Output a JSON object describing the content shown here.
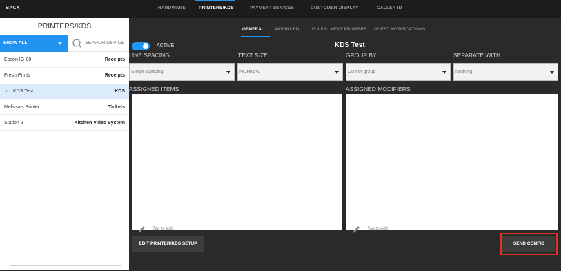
{
  "topbar": {
    "back_label": "BACK",
    "tabs": [
      {
        "label": "HARDWARE",
        "active": false
      },
      {
        "label": "PRINTERS/KDS",
        "active": true
      },
      {
        "label": "PAYMENT DEVICES",
        "active": false
      },
      {
        "label": "CUSTOMER DISPLAY",
        "active": false
      },
      {
        "label": "CALLER ID",
        "active": false
      }
    ]
  },
  "sidebar": {
    "title": "PRINTERS/KDS",
    "filter_label": "SHOW ALL",
    "search_placeholder": "SEARCH DEVICE",
    "devices": [
      {
        "name": "Epson IG-88",
        "type": "Receipts",
        "selected": false
      },
      {
        "name": "Fresh Prints",
        "type": "Receipts",
        "selected": false
      },
      {
        "name": "KDS Test",
        "type": "KDS",
        "selected": true
      },
      {
        "name": "Melissa's Printer",
        "type": "Tickets",
        "selected": false
      },
      {
        "name": "Station 2",
        "type": "Kitchen Video System",
        "selected": false
      }
    ],
    "check_glyph": "✓"
  },
  "subtabs": [
    {
      "label": "GENERAL",
      "active": true
    },
    {
      "label": "ADVANCED",
      "active": false
    },
    {
      "label": "FULFILLMENT PRINTERS",
      "active": false
    },
    {
      "label": "GUEST NOTIFICATIONS",
      "active": false
    }
  ],
  "form": {
    "active_label": "ACTIVE",
    "active_on": true,
    "device_title": "KDS Test",
    "fields": [
      {
        "label": "LINE SPACING",
        "value": "Single Spacing"
      },
      {
        "label": "TEXT SIZE",
        "value": "NORMAL"
      },
      {
        "label": "GROUP BY",
        "value": "Do not group"
      },
      {
        "label": "SEPARATE WITH",
        "value": "Nothing"
      }
    ],
    "assigned_items_label": "ASSIGNED ITEMS",
    "assigned_modifiers_label": "ASSIGNED MODIFIERS",
    "tap_to_edit": "Tap to edit"
  },
  "actions": {
    "edit_setup_label": "EDIT PRINTER/KDS SETUP",
    "send_config_label": "SEND CONFIG"
  },
  "colors": {
    "accent": "#2196f3",
    "highlight": "#e0342b",
    "selected_row": "#dcebfa"
  },
  "icons": {
    "search": "search-icon",
    "pencil": "pencil-icon",
    "caret": "chevron-down-icon",
    "check": "check-icon"
  }
}
